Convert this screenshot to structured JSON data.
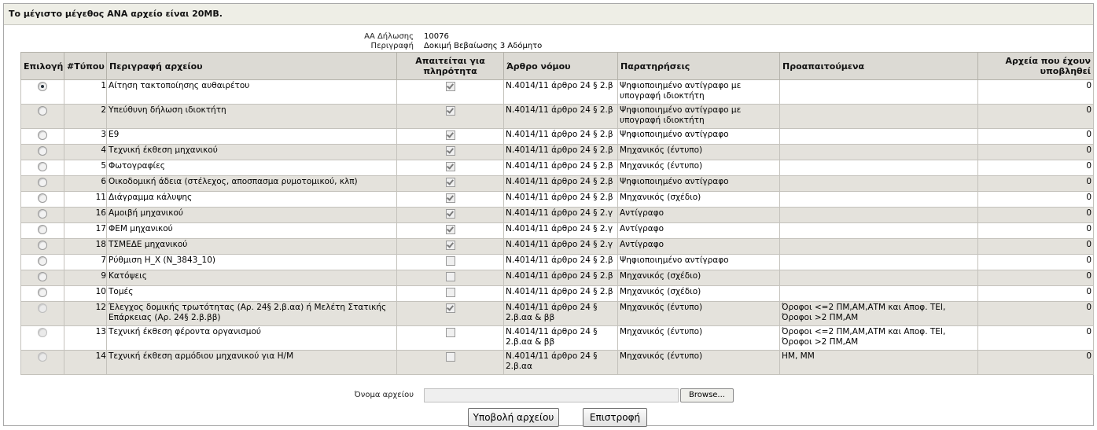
{
  "header": {
    "title": "Το μέγιστο μέγεθος ΑΝΑ αρχείο είναι 20MB."
  },
  "info": {
    "declaration_label": "ΑΑ Δήλωσης",
    "declaration_value": "10076",
    "description_label": "Περιγραφή",
    "description_value": "Δοκιμή Βεβαίωσης 3 Αδόμητο"
  },
  "table": {
    "headers": {
      "select": "Επιλογή",
      "type_no": "#Τύπου",
      "description": "Περιγραφή αρχείου",
      "required": "Απαιτείται για πληρότητα",
      "law_article": "Άρθρο νόμου",
      "remarks": "Παρατηρήσεις",
      "prerequisites": "Προαπαιτούμενα",
      "submitted": "Αρχεία που έχουν υποβληθεί"
    },
    "rows": [
      {
        "num": "1",
        "desc": "Αίτηση τακτοποίησης αυθαιρέτου",
        "req": true,
        "law": "Ν.4014/11 άρθρο 24 § 2.β",
        "remarks": "Ψηφιοποιημένο αντίγραφο με υπογραφή ιδιοκτήτη",
        "prereq": "",
        "submitted": "0",
        "selected": true,
        "enabled": true
      },
      {
        "num": "2",
        "desc": "Υπεύθυνη δήλωση ιδιοκτήτη",
        "req": true,
        "law": "Ν.4014/11 άρθρο 24 § 2.β",
        "remarks": "Ψηφιοποιημένο αντίγραφο με υπογραφή ιδιοκτήτη",
        "prereq": "",
        "submitted": "0",
        "selected": false,
        "enabled": true
      },
      {
        "num": "3",
        "desc": "Ε9",
        "req": true,
        "law": "Ν.4014/11 άρθρο 24 § 2.β",
        "remarks": "Ψηφιοποιημένο αντίγραφο",
        "prereq": "",
        "submitted": "0",
        "selected": false,
        "enabled": true
      },
      {
        "num": "4",
        "desc": "Τεχνική έκθεση μηχανικού",
        "req": true,
        "law": "Ν.4014/11 άρθρο 24 § 2.β",
        "remarks": "Μηχανικός (έντυπο)",
        "prereq": "",
        "submitted": "0",
        "selected": false,
        "enabled": true
      },
      {
        "num": "5",
        "desc": "Φωτογραφίες",
        "req": true,
        "law": "Ν.4014/11 άρθρο 24 § 2.β",
        "remarks": "Μηχανικός (έντυπο)",
        "prereq": "",
        "submitted": "0",
        "selected": false,
        "enabled": true
      },
      {
        "num": "6",
        "desc": "Οικοδομική άδεια (στέλεχος, αποσπασμα ρυμοτομικού, κλπ)",
        "req": true,
        "law": "Ν.4014/11 άρθρο 24 § 2.β",
        "remarks": "Ψηφιοποιημένο αντίγραφο",
        "prereq": "",
        "submitted": "0",
        "selected": false,
        "enabled": true
      },
      {
        "num": "11",
        "desc": "Διάγραμμα κάλυψης",
        "req": true,
        "law": "Ν.4014/11 άρθρο 24 § 2.β",
        "remarks": "Μηχανικός (σχέδιο)",
        "prereq": "",
        "submitted": "0",
        "selected": false,
        "enabled": true
      },
      {
        "num": "16",
        "desc": "Αμοιβή μηχανικού",
        "req": true,
        "law": "Ν.4014/11 άρθρο 24 § 2.γ",
        "remarks": "Αντίγραφο",
        "prereq": "",
        "submitted": "0",
        "selected": false,
        "enabled": true
      },
      {
        "num": "17",
        "desc": "ΦΕΜ μηχανικού",
        "req": true,
        "law": "Ν.4014/11 άρθρο 24 § 2.γ",
        "remarks": "Αντίγραφο",
        "prereq": "",
        "submitted": "0",
        "selected": false,
        "enabled": true
      },
      {
        "num": "18",
        "desc": "ΤΣΜΕΔΕ μηχανικού",
        "req": true,
        "law": "Ν.4014/11 άρθρο 24 § 2.γ",
        "remarks": "Αντίγραφο",
        "prereq": "",
        "submitted": "0",
        "selected": false,
        "enabled": true
      },
      {
        "num": "7",
        "desc": "Ρύθμιση Η_Χ (Ν_3843_10)",
        "req": false,
        "law": "Ν.4014/11 άρθρο 24 § 2.β",
        "remarks": "Ψηφιοποιημένο αντίγραφο",
        "prereq": "",
        "submitted": "0",
        "selected": false,
        "enabled": true
      },
      {
        "num": "9",
        "desc": "Κατόψεις",
        "req": false,
        "law": "Ν.4014/11 άρθρο 24 § 2.β",
        "remarks": "Μηχανικός (σχέδιο)",
        "prereq": "",
        "submitted": "0",
        "selected": false,
        "enabled": true
      },
      {
        "num": "10",
        "desc": "Τομές",
        "req": false,
        "law": "Ν.4014/11 άρθρο 24 § 2.β",
        "remarks": "Μηχανικός (σχέδιο)",
        "prereq": "",
        "submitted": "0",
        "selected": false,
        "enabled": true
      },
      {
        "num": "12",
        "desc": "Έλεγχος δομικής τρωτότητας (Αρ. 24§ 2.β.αα) ή Μελέτη Στατικής Επάρκειας (Αρ. 24§ 2.β.ββ)",
        "req": true,
        "law": "Ν.4014/11 άρθρο 24 § 2.β.αα & ββ",
        "remarks": "Μηχανικός (έντυπο)",
        "prereq": "Όροφοι <=2 ΠΜ,ΑΜ,ΑΤΜ και Αποφ. ΤΕΙ, Όροφοι >2 ΠΜ,ΑΜ",
        "submitted": "0",
        "selected": false,
        "enabled": false
      },
      {
        "num": "13",
        "desc": "Τεχνική έκθεση φέροντα οργανισμού",
        "req": false,
        "law": "Ν.4014/11 άρθρο 24 § 2.β.αα & ββ",
        "remarks": "Μηχανικός (έντυπο)",
        "prereq": "Όροφοι <=2 ΠΜ,ΑΜ,ΑΤΜ και Αποφ. ΤΕΙ, Όροφοι >2 ΠΜ,ΑΜ",
        "submitted": "0",
        "selected": false,
        "enabled": false
      },
      {
        "num": "14",
        "desc": "Τεχνική έκθεση αρμόδιου μηχανικού για Η/Μ",
        "req": false,
        "law": "Ν.4014/11 άρθρο 24 § 2.β.αα",
        "remarks": "Μηχανικός (έντυπο)",
        "prereq": "ΗΜ, ΜΜ",
        "submitted": "0",
        "selected": false,
        "enabled": false
      }
    ]
  },
  "upload": {
    "file_label": "Όνομα αρχείου",
    "file_value": "",
    "browse_label": "Browse..."
  },
  "buttons": {
    "submit_label": "Υποβολή αρχείου",
    "back_label": "Επιστροφή"
  }
}
